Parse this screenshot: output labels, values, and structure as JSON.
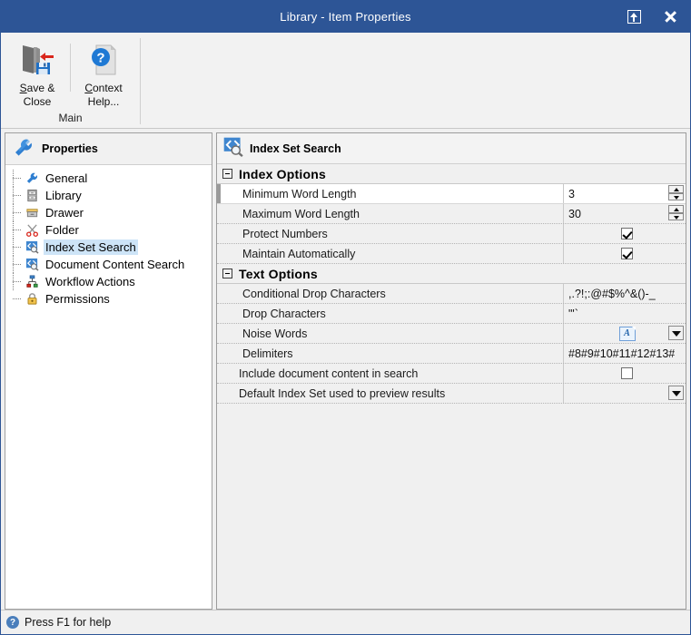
{
  "window": {
    "title": "Library - Item Properties",
    "restore_icon": "restore-icon",
    "close_icon": "close-icon",
    "accent_color": "#2d5596"
  },
  "ribbon": {
    "group_label": "Main",
    "buttons": [
      {
        "id": "save-close",
        "label_line1": "Save &",
        "label_line2": "Close",
        "accel": "S",
        "icon": "save-and-close-icon"
      },
      {
        "id": "context-help",
        "label_line1": "Context",
        "label_line2": "Help...",
        "accel": "C",
        "icon": "context-help-icon"
      }
    ]
  },
  "sidebar": {
    "header": "Properties",
    "header_icon": "wrench-icon",
    "items": [
      {
        "label": "General",
        "icon": "wrench-icon",
        "selected": false
      },
      {
        "label": "Library",
        "icon": "cabinet-icon",
        "selected": false
      },
      {
        "label": "Drawer",
        "icon": "drawer-icon",
        "selected": false
      },
      {
        "label": "Folder",
        "icon": "scissors-icon",
        "selected": false
      },
      {
        "label": "Index Set Search",
        "icon": "index-search-icon",
        "selected": true
      },
      {
        "label": "Document Content Search",
        "icon": "index-search-icon",
        "selected": false
      },
      {
        "label": "Workflow Actions",
        "icon": "workflow-icon",
        "selected": false
      },
      {
        "label": "Permissions",
        "icon": "lock-icon",
        "selected": false
      }
    ]
  },
  "content": {
    "header_title": "Index Set Search",
    "header_icon": "index-search-icon",
    "sections": [
      {
        "title": "Index Options",
        "expanded": true,
        "rows": [
          {
            "name": "Minimum Word Length",
            "value": "3",
            "control": "spinner",
            "selected": true,
            "toplevel": false
          },
          {
            "name": "Maximum Word Length",
            "value": "30",
            "control": "spinner",
            "selected": false,
            "toplevel": false
          },
          {
            "name": "Protect Numbers",
            "value": "",
            "control": "checkbox",
            "checked": true,
            "selected": false,
            "toplevel": false
          },
          {
            "name": "Maintain Automatically",
            "value": "",
            "control": "checkbox",
            "checked": true,
            "selected": false,
            "toplevel": false
          }
        ]
      },
      {
        "title": "Text Options",
        "expanded": true,
        "rows": [
          {
            "name": "Conditional Drop Characters",
            "value": ",.?!;:@#$%^&()-_",
            "control": "text",
            "selected": false,
            "toplevel": false
          },
          {
            "name": "Drop Characters",
            "value": "\"'`",
            "control": "text",
            "selected": false,
            "toplevel": false
          },
          {
            "name": "Noise Words",
            "value": "",
            "control": "abutton-dropdown",
            "selected": false,
            "toplevel": false
          },
          {
            "name": "Delimiters",
            "value": "#8#9#10#11#12#13#",
            "control": "text",
            "selected": false,
            "toplevel": false
          },
          {
            "name": "Include document content in search",
            "value": "",
            "control": "checkbox",
            "checked": false,
            "selected": false,
            "toplevel": true
          },
          {
            "name": "Default Index Set used to preview results",
            "value": "",
            "control": "dropdown",
            "selected": false,
            "toplevel": true
          }
        ]
      }
    ]
  },
  "statusbar": {
    "icon": "help-question-icon",
    "text": "Press F1 for help"
  }
}
